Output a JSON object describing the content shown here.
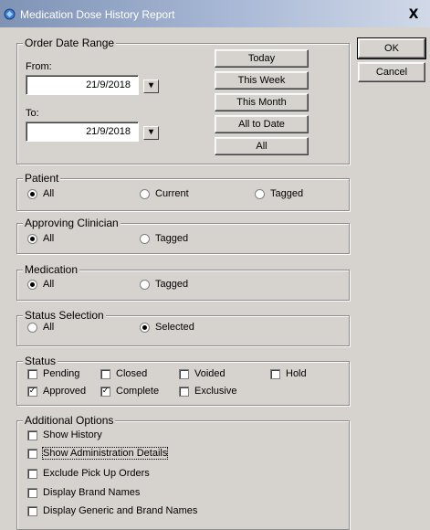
{
  "window": {
    "title": "Medication Dose History Report",
    "close_glyph": "X"
  },
  "side_buttons": {
    "ok": "OK",
    "cancel": "Cancel"
  },
  "order_date_range": {
    "title": "Order Date Range",
    "from_label": "From:",
    "from_value": "21/9/2018",
    "to_label": "To:",
    "to_value": "21/9/2018",
    "buttons": [
      "Today",
      "This Week",
      "This Month",
      "All to Date",
      "All"
    ]
  },
  "patient": {
    "title": "Patient",
    "options": [
      "All",
      "Current",
      "Tagged"
    ],
    "selected": "All"
  },
  "approving_clinician": {
    "title": "Approving Clinician",
    "options": [
      "All",
      "Tagged"
    ],
    "selected": "All"
  },
  "medication": {
    "title": "Medication",
    "options": [
      "All",
      "Tagged"
    ],
    "selected": "All"
  },
  "status_selection": {
    "title": "Status Selection",
    "options": [
      "All",
      "Selected"
    ],
    "selected": "Selected"
  },
  "status": {
    "title": "Status",
    "items": [
      {
        "label": "Pending",
        "checked": false
      },
      {
        "label": "Closed",
        "checked": false
      },
      {
        "label": "Voided",
        "checked": false
      },
      {
        "label": "Hold",
        "checked": false
      },
      {
        "label": "Approved",
        "checked": true
      },
      {
        "label": "Complete",
        "checked": true
      },
      {
        "label": "Exclusive",
        "checked": false
      }
    ]
  },
  "additional_options": {
    "title": "Additional Options",
    "items": [
      {
        "label": "Show History",
        "checked": false
      },
      {
        "label": "Show Administration Details",
        "checked": false
      },
      {
        "label": "Exclude Pick Up Orders",
        "checked": false
      },
      {
        "label": "Display Brand Names",
        "checked": false
      },
      {
        "label": "Display Generic and Brand Names",
        "checked": false
      }
    ]
  }
}
